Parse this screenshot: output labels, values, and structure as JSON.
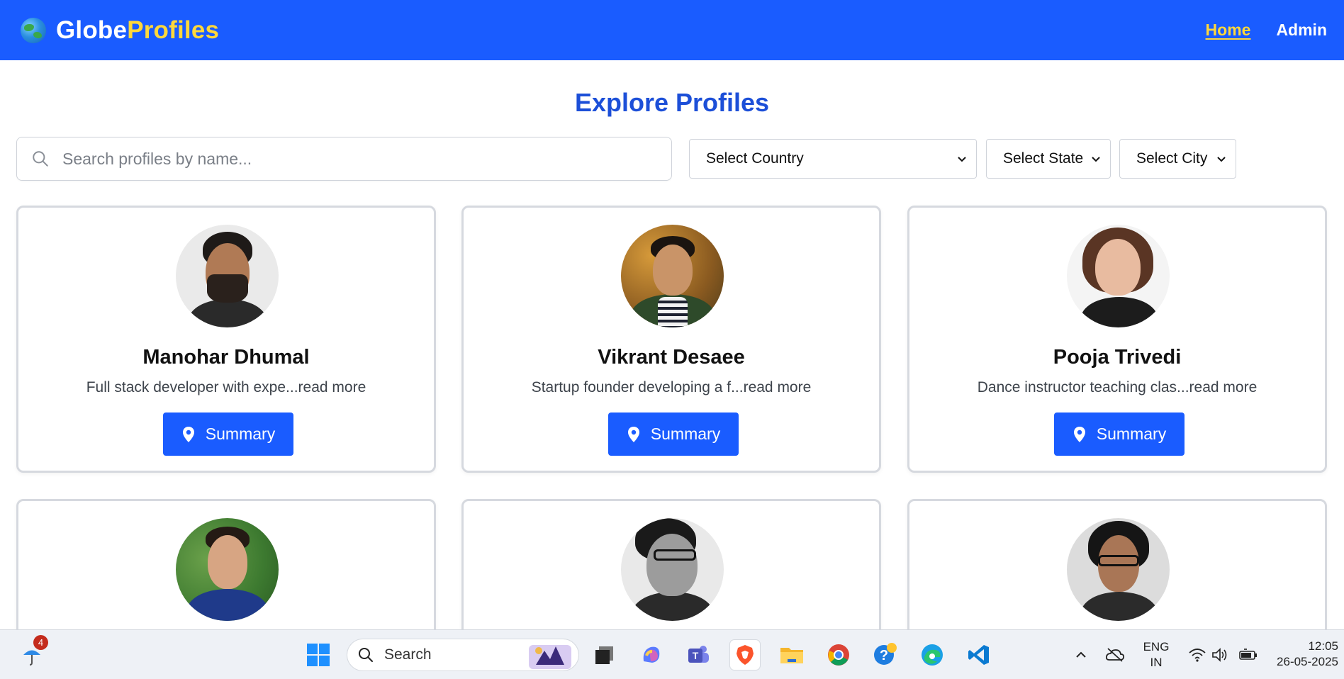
{
  "navbar": {
    "brand_part1": "Globe",
    "brand_part2": "Profiles",
    "links": [
      {
        "label": "Home",
        "active": true
      },
      {
        "label": "Admin",
        "active": false
      }
    ],
    "colors": {
      "bar": "#1a5cff",
      "accent": "#ffd83a"
    }
  },
  "page": {
    "title": "Explore Profiles"
  },
  "filters": {
    "search_placeholder": "Search profiles by name...",
    "country": "Select Country",
    "state": "Select State",
    "city": "Select City"
  },
  "profiles": [
    {
      "name": "Manohar Dhumal",
      "description": "Full stack developer with expe...read more",
      "button": "Summary"
    },
    {
      "name": "Vikrant Desaee",
      "description": "Startup founder developing a f...read more",
      "button": "Summary"
    },
    {
      "name": "Pooja Trivedi",
      "description": "Dance instructor teaching clas...read more",
      "button": "Summary"
    }
  ],
  "taskbar": {
    "notification_count": "4",
    "search_label": "Search",
    "language_line1": "ENG",
    "language_line2": "IN",
    "time": "12:05",
    "date": "26-05-2025",
    "icons": [
      "weather-icon",
      "windows-start-icon",
      "task-view-icon",
      "copilot-icon",
      "teams-icon",
      "brave-icon",
      "file-explorer-icon",
      "chrome-icon",
      "help-icon",
      "edge-icon",
      "vscode-icon"
    ]
  }
}
